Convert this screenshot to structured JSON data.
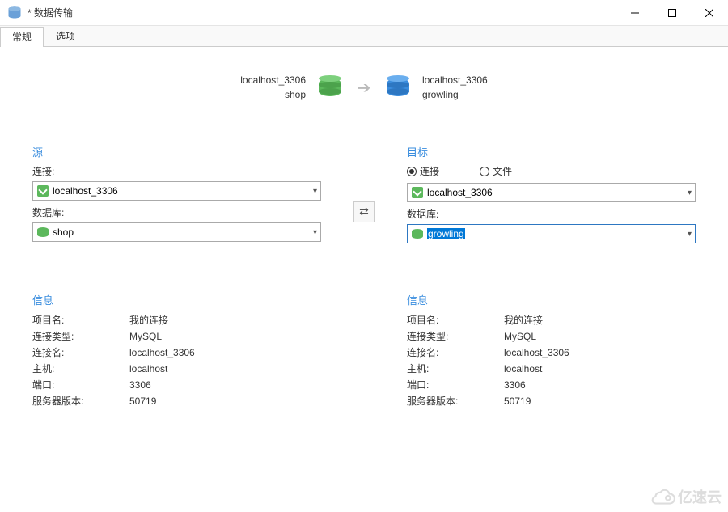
{
  "window": {
    "title": "* 数据传输"
  },
  "tabs": {
    "general": "常规",
    "options": "选项"
  },
  "diagram": {
    "source_conn": "localhost_3306",
    "source_db": "shop",
    "target_conn": "localhost_3306",
    "target_db": "growling"
  },
  "source": {
    "heading": "源",
    "conn_label": "连接:",
    "conn_value": "localhost_3306",
    "db_label": "数据库:",
    "db_value": "shop"
  },
  "target": {
    "heading": "目标",
    "radio_conn": "连接",
    "radio_file": "文件",
    "conn_value": "localhost_3306",
    "db_label": "数据库:",
    "db_value": "growling"
  },
  "info_heading": "信息",
  "info_keys": {
    "project": "项目名:",
    "conn_type": "连接类型:",
    "conn_name": "连接名:",
    "host": "主机:",
    "port": "端口:",
    "server_ver": "服务器版本:"
  },
  "source_info": {
    "project": "我的连接",
    "conn_type": "MySQL",
    "conn_name": "localhost_3306",
    "host": "localhost",
    "port": "3306",
    "server_ver": "50719"
  },
  "target_info": {
    "project": "我的连接",
    "conn_type": "MySQL",
    "conn_name": "localhost_3306",
    "host": "localhost",
    "port": "3306",
    "server_ver": "50719"
  },
  "watermark": "亿速云"
}
